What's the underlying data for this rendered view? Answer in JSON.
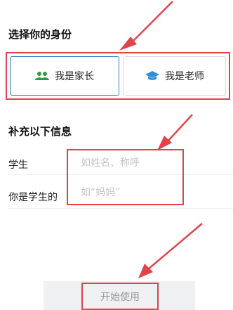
{
  "role_section": {
    "title": "选择你的身份",
    "parent_label": "我是家长",
    "teacher_label": "我是老师",
    "selected": "parent"
  },
  "info_section": {
    "title": "补充以下信息",
    "student_label": "学生",
    "student_placeholder": "如姓名、称呼",
    "relation_label": "你是学生的",
    "relation_placeholder": "如“妈妈”"
  },
  "start_button": {
    "label": "开始使用"
  },
  "colors": {
    "highlight": "#e2434b",
    "parent_icon": "#2e9a3e",
    "teacher_icon": "#2f8fd8"
  }
}
